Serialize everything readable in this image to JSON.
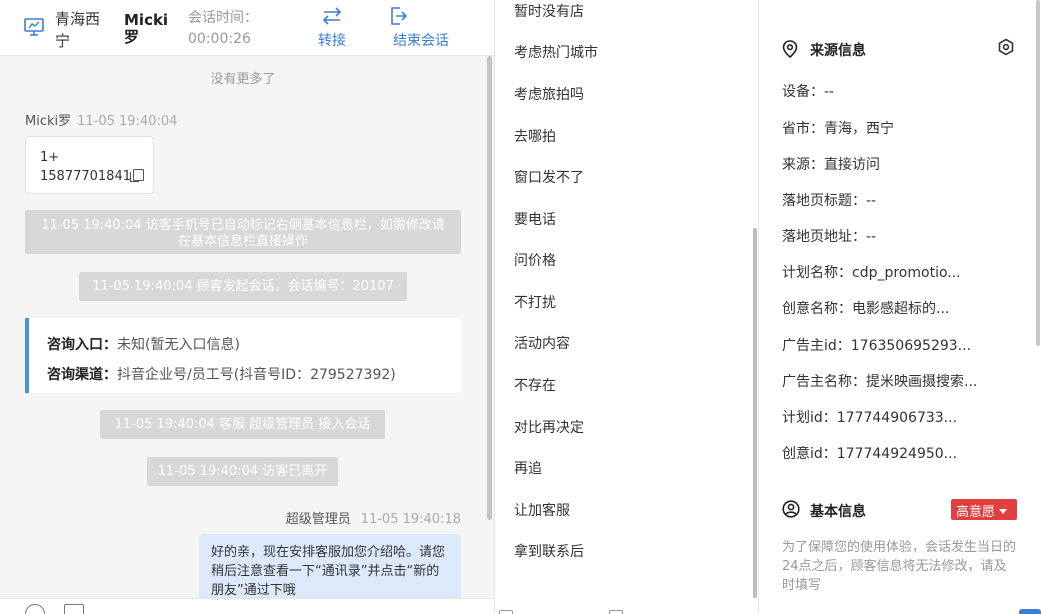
{
  "header": {
    "location": "青海西宁",
    "visitor_name": "Micki罗",
    "session_time_label": "会话时间：",
    "session_time_value": "00:00:26",
    "transfer_label": "转接",
    "end_label": "结束会话"
  },
  "chat": {
    "no_more": "没有更多了",
    "visitor_msg": {
      "sender": "Micki罗",
      "time": "11-05 19:40:04",
      "line1": "1+",
      "line2": "15877701841"
    },
    "system_msgs": [
      "11-05 19:40:04 访客手机号已自动标记右侧基本信息栏，如需修改请在基本信息栏直接操作",
      "11-05 19:40:04 顾客发起会话，会话编号：20107",
      "11-05 19:40:04 客服 超级管理员 接入会话",
      "11-05 19:40:04 访客已离开"
    ],
    "consult": {
      "entry_label": "咨询入口：",
      "entry_value": "未知(暂无入口信息)",
      "channel_label": "咨询渠道：",
      "channel_value": "抖音企业号/员工号(抖音号ID：279527392)"
    },
    "agent_msg": {
      "sender": "超级管理员",
      "time": "11-05 19:40:18",
      "text": "好的亲，现在安排客服加您介绍哈。请您稍后注意查看一下“通讯录”并点击“新的朋友”通过下哦"
    }
  },
  "quick_replies": [
    "暂时没有店",
    "考虑热门城市",
    "考虑旅拍吗",
    "去哪拍",
    "窗口发不了",
    "要电话",
    "问价格",
    "不打扰",
    "活动内容",
    "不存在",
    "对比再决定",
    "再追",
    "让加客服",
    "拿到联系后"
  ],
  "source_info": {
    "title": "来源信息",
    "rows": [
      "设备：--",
      "省市：青海，西宁",
      "来源：直接访问",
      "落地页标题：--",
      "落地页地址：--",
      "计划名称：cdp_promotio...",
      "创意名称：电影感超标的...",
      "广告主id：176350695293...",
      "广告主名称：提米映画摄搜索...",
      "计划id：177744906733...",
      "创意id：177744924950..."
    ]
  },
  "basic_info": {
    "title": "基本信息",
    "intent_badge": "高意愿",
    "note": "为了保障您的使用体验，会话发生当日的24点之后，顾客信息将无法修改，请及时填写"
  },
  "colors": {
    "accent": "#3b7fd4",
    "badge_red": "#e04040",
    "system_gray": "#d8d8d8",
    "agent_bubble": "#dbe9fb"
  }
}
